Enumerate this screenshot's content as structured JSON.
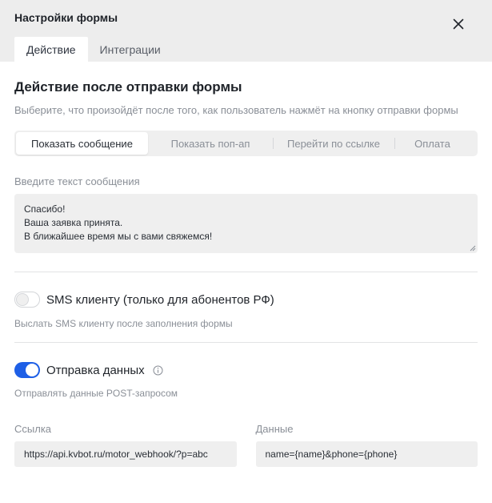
{
  "dialog": {
    "title": "Настройки формы",
    "tabs": [
      {
        "label": "Действие",
        "active": true
      },
      {
        "label": "Интеграции",
        "active": false
      }
    ]
  },
  "action": {
    "title": "Действие после отправки формы",
    "description": "Выберите, что произойдёт после того, как пользователь нажмёт на кнопку отправки формы",
    "segments": [
      {
        "label": "Показать сообщение",
        "active": true
      },
      {
        "label": "Показать поп-ап",
        "active": false
      },
      {
        "label": "Перейти по ссылке",
        "active": false
      },
      {
        "label": "Оплата",
        "active": false
      }
    ]
  },
  "message": {
    "label": "Введите текст сообщения",
    "lines": [
      "Спасибо!",
      "Ваша заявка принята.",
      "В ближайшее время мы с вами свяжемся!"
    ]
  },
  "sms": {
    "label": "SMS клиенту (только для абонентов РФ)",
    "hint": "Выслать SMS клиенту после заполнения формы",
    "enabled": false
  },
  "post": {
    "label": "Отправка данных",
    "hint": "Отправлять данные POST-запросом",
    "enabled": true,
    "url_label": "Ссылка",
    "url_value": "https://api.kvbot.ru/motor_webhook/?p=abc",
    "data_label": "Данные",
    "data_value": "name={name}&phone={phone}"
  },
  "colors": {
    "accent": "#1e5fe6",
    "header_bg": "#ededed",
    "field_bg": "#efefef"
  },
  "icons": {
    "close": "close-icon",
    "info": "info-icon",
    "resize": "resize-handle-icon"
  }
}
